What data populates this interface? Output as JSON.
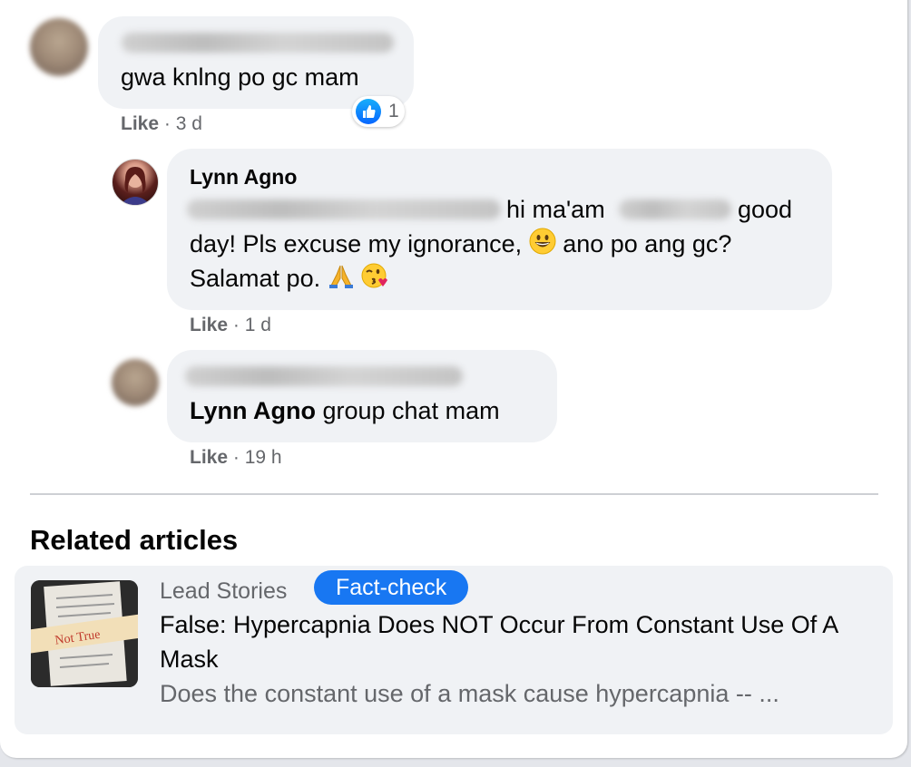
{
  "comments": [
    {
      "text": "gwa knlng po gc mam",
      "reaction_count": "1",
      "like_label": "Like",
      "time": "3 d"
    },
    {
      "author": "Lynn Agno",
      "line1_mid": "hi ma'am",
      "line1_end": "good",
      "line2_a": "day! Pls excuse my ignorance,",
      "line2_b": "ano po ang gc?",
      "line3": "Salamat po.",
      "like_label": "Like",
      "time": "1 d"
    },
    {
      "mention": "Lynn Agno",
      "text": "group chat mam",
      "like_label": "Like",
      "time": "19 h"
    }
  ],
  "separator": "·",
  "related": {
    "title": "Related articles",
    "article": {
      "source": "Lead Stories",
      "badge": "Fact-check",
      "thumb_stamp": "Not True",
      "title": "False: Hypercapnia Does NOT Occur From Constant Use Of A Mask",
      "description": "Does the constant use of a mask cause hypercapnia -- ..."
    }
  },
  "icons": [
    "thumbs-up-icon",
    "grinning-face-icon",
    "folded-hands-icon",
    "face-blowing-kiss-icon"
  ],
  "colors": {
    "accent": "#1877f2",
    "bubble": "#f0f2f5",
    "meta_text": "#65676b"
  }
}
